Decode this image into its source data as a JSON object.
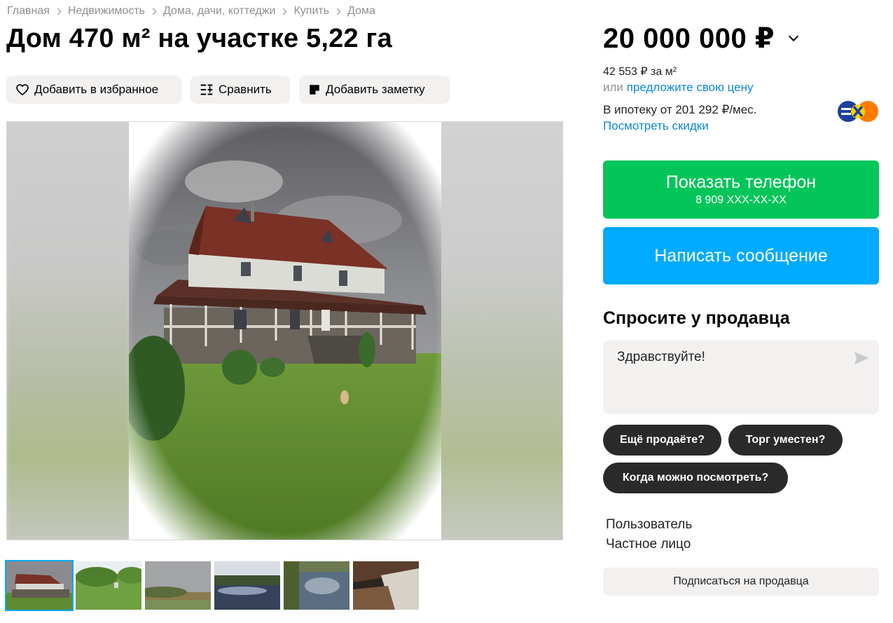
{
  "breadcrumbs": [
    "Главная",
    "Недвижимость",
    "Дома, дачи, коттеджи",
    "Купить",
    "Дома"
  ],
  "listing": {
    "title": "Дом 470 м² на участке 5,22 га"
  },
  "actions": {
    "favorite": "Добавить в избранное",
    "compare": "Сравнить",
    "note": "Добавить заметку"
  },
  "gallery": {
    "thumbnails_count": 6,
    "active_index": 0
  },
  "price": {
    "value": "20 000 000 ₽",
    "per_m2": "42 553 ₽ за м²",
    "offer_prefix": "или",
    "offer_link": "предложите свою цену",
    "mortgage": "В ипотеку от 201 292 ₽/мес.",
    "discounts_link": "Посмотреть скидки"
  },
  "contact": {
    "phone_label": "Показать телефон",
    "phone_masked": "8 909 XXX-XX-XX",
    "message_label": "Написать сообщение"
  },
  "ask": {
    "title": "Спросите у продавца",
    "input_value": "Здравствуйте!",
    "chips": [
      "Ещё продаёте?",
      "Торг уместен?",
      "Когда можно посмотреть?"
    ]
  },
  "seller": {
    "name": "Пользователь",
    "type": "Частное лицо",
    "subscribe_label": "Подписаться на продавца"
  },
  "colors": {
    "phone_button": "#04c55a",
    "message_button": "#00aaff",
    "link": "#0a88d8",
    "chip": "#2a2a2a"
  }
}
